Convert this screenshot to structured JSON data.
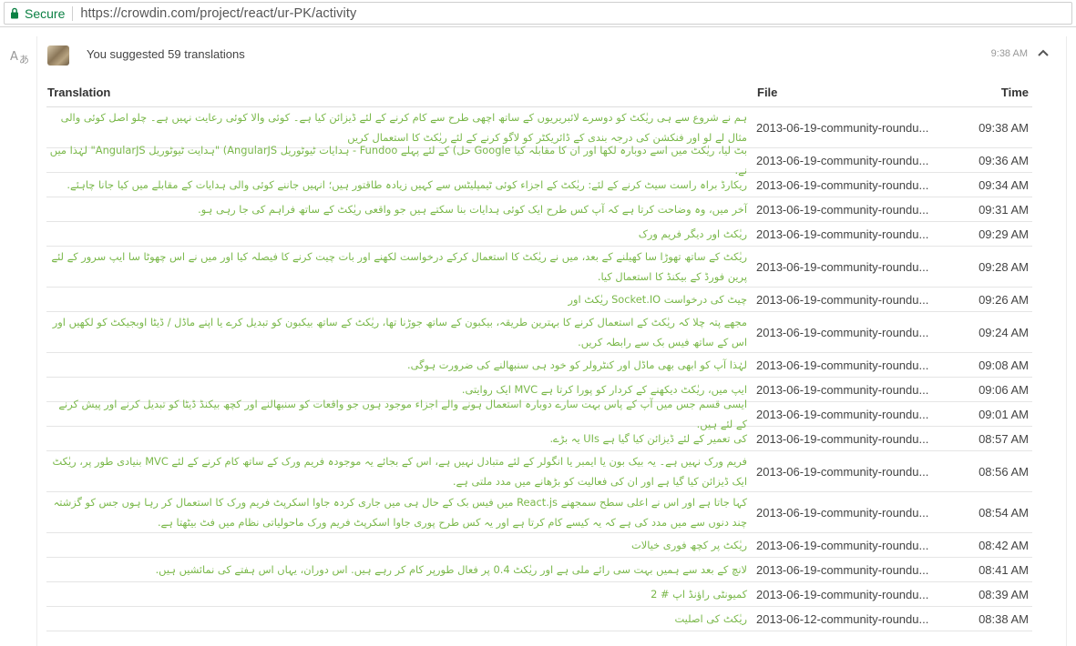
{
  "browser": {
    "secure_label": "Secure",
    "url": "https://crowdin.com/project/react/ur-PK/activity"
  },
  "activity": {
    "summary": "You suggested 59 translations",
    "time": "9:38 AM"
  },
  "table": {
    "headers": {
      "translation": "Translation",
      "file": "File",
      "time": "Time"
    },
    "rows": [
      {
        "translation": "ہم نے شروع سے ہی ریٰکٹ کو دوسرے لائبریریوں کے ساتھ اچھی طرح سے کام کرنے کے لئے ڈیزائن کیا ہے۔ کوئی والا کوئی رعایت نہیں ہے۔ چلو اصل کوئی والی مثال لے لو اور فنکشن کی درجہ بندی کے ڈائریکٹر کو لاگو کرنے کے لئے ریٰکٹ کا استعمال کریں",
        "file": "2013-06-19-community-roundu...",
        "time": "09:38 AM"
      },
      {
        "translation": "بٹ لیا، ریٰکٹ میں اسے دوبارہ لکھا اور ان کا مقابلہ کیا Google حل) کے لئے پہلے Fundoo - ہدایات ٹیوٹوریل AngularJS) \"ہدایت ٹیوٹوریل AngularJS\" لہٰذا میں نے.",
        "file": "2013-06-19-community-roundu...",
        "time": "09:36 AM"
      },
      {
        "translation": "ریکارڈ براہ راست سیٹ کرنے کے لئے: ریٰکٹ کے اجزاء کوئی ٹیمپلیٹس سے کہیں زیادہ طاقتور ہیں؛ انہیں جاننے کوئی والی ہدایات کے مقابلے میں کیا جانا چاہئے.",
        "file": "2013-06-19-community-roundu...",
        "time": "09:34 AM"
      },
      {
        "translation": "آخر میں، وہ وضاحت کرتا ہے کہ آپ کس طرح ایک کوئی ہدایات بنا سکتے ہیں جو واقعی ریٰکٹ کے ساتھ فراہم کی جا رہی ہو.",
        "file": "2013-06-19-community-roundu...",
        "time": "09:31 AM"
      },
      {
        "translation": "ریٰکٹ اور دیگر فریم ورک",
        "file": "2013-06-19-community-roundu...",
        "time": "09:29 AM"
      },
      {
        "translation": "ریٰکٹ کے ساتھ تھوڑا سا کھیلنے کے بعد، میں نے ریٰکٹ کا استعمال کرکے درخواست لکھنے اور بات چیت کرنے کا فیصلہ کیا اور میں نے اس چھوٹا سا ایپ سرور کے لئے پرین فورڈ کے بیکنڈ کا استعمال کیا.",
        "file": "2013-06-19-community-roundu...",
        "time": "09:28 AM"
      },
      {
        "translation": "چیٹ کی درخواست Socket.IO ریٰکٹ اور",
        "file": "2013-06-19-community-roundu...",
        "time": "09:26 AM"
      },
      {
        "translation": "مجھے پتہ چلا کہ ریٰکٹ کے استعمال کرنے کا بہترین طریقہ، بیکبون کے ساتھ جوڑنا تھا، ریٰکٹ کے ساتھ بیکبون کو تبدیل کرے یا اپنے ماڈل / ڈیٹا اوبجیکٹ کو لکھیں اور اس کے ساتھ فیس بک سے رابطہ کریں.",
        "file": "2013-06-19-community-roundu...",
        "time": "09:24 AM"
      },
      {
        "translation": "لہٰذا آپ کو ابھی بھی ماڈل اور کنٹرولر کو خود ہی سنبھالنے کی ضرورت ہوگی.",
        "file": "2013-06-19-community-roundu...",
        "time": "09:08 AM"
      },
      {
        "translation": "ایپ میں، ریٰکٹ دیکھنے کے کردار کو پورا کرتا ہے MVC ایک روایتی.",
        "file": "2013-06-19-community-roundu...",
        "time": "09:06 AM"
      },
      {
        "translation": "ایسی قسم جس میں آپ کے پاس بہت سارے دوبارہ استعمال ہونے والے اجزاء موجود ہوں جو واقعات کو سنبھالنے اور کچھ بیکنڈ ڈیٹا کو تبدیل کرنے اور پیش کرنے کے لئے ہیں.",
        "file": "2013-06-19-community-roundu...",
        "time": "09:01 AM"
      },
      {
        "translation": "کی تعمیر کے لئے ڈیزائن کیا گیا ہے UIs یہ بڑے.",
        "file": "2013-06-19-community-roundu...",
        "time": "08:57 AM"
      },
      {
        "translation": "فریم ورک نہیں ہے۔ یہ بیک بون یا ایمبر یا انگولر کے لئے متبادل نہیں ہے، اس کے بجائے یہ موجودہ فریم ورک کے ساتھ کام کرنے کے لئے MVC بنیادی طور پر، ریٰکٹ ایک ڈیزائن کیا گیا ہے اور ان کی فعالیت کو بڑھانے میں مدد ملتی ہے.",
        "file": "2013-06-19-community-roundu...",
        "time": "08:56 AM"
      },
      {
        "translation": "کہا جاتا ہے اور اس نے اعلی سطح سمجھنے React.js میں فیس بک کے حال ہی میں جاری کردہ جاوا اسکرپٹ فریم ورک کا استعمال کر رہا ہوں جس کو گزشتہ چند دنوں سے میں مدد کی ہے کہ یہ کیسے کام کرتا ہے اور یہ کس طرح پوری جاوا اسکرپٹ فریم ورک ماحولیاتی نظام میں فٹ بیٹھتا ہے.",
        "file": "2013-06-19-community-roundu...",
        "time": "08:54 AM"
      },
      {
        "translation": "ریٰکٹ پر کچھ فوری خیالات",
        "file": "2013-06-19-community-roundu...",
        "time": "08:42 AM"
      },
      {
        "translation": "لانچ کے بعد سے ہمیں بہت سی رائے ملی ہے اور ریٰکٹ 0.4 پر فعال طورپر کام کر رہے ہیں. اس دوران، یہاں اس ہفتے کی نمائشیں ہیں.",
        "file": "2013-06-19-community-roundu...",
        "time": "08:41 AM"
      },
      {
        "translation": "کمیونٹی راؤنڈ اپ # 2",
        "file": "2013-06-19-community-roundu...",
        "time": "08:39 AM"
      },
      {
        "translation": "ریٰکٹ کی اصلیت",
        "file": "2013-06-12-community-roundu...",
        "time": "08:38 AM"
      }
    ]
  }
}
